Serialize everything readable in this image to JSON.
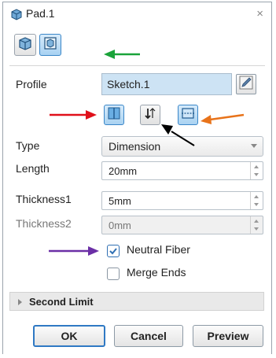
{
  "window": {
    "title": "Pad.1",
    "close_symbol": "×"
  },
  "toolbar": {
    "buttons": [
      "pad-icon",
      "sketch-view-icon"
    ]
  },
  "profile": {
    "label": "Profile",
    "value": "Sketch.1"
  },
  "direction_buttons": [
    "reverse-side-icon",
    "reverse-direction-icon",
    "mirrored-extent-icon"
  ],
  "type": {
    "label": "Type",
    "value": "Dimension"
  },
  "length": {
    "label": "Length",
    "value": "20mm"
  },
  "thickness1": {
    "label": "Thickness1",
    "value": "5mm"
  },
  "thickness2": {
    "label": "Thickness2",
    "value": "0mm"
  },
  "neutral_fiber": {
    "label": "Neutral Fiber",
    "checked": true
  },
  "merge_ends": {
    "label": "Merge Ends",
    "checked": false
  },
  "second_limit": {
    "label": "Second Limit"
  },
  "actions": {
    "ok": "OK",
    "cancel": "Cancel",
    "preview": "Preview"
  },
  "annotations": {
    "green": "#1aa33a",
    "red": "#e0101a",
    "black": "#000000",
    "orange": "#e8731a",
    "purple": "#6b2fa6"
  }
}
